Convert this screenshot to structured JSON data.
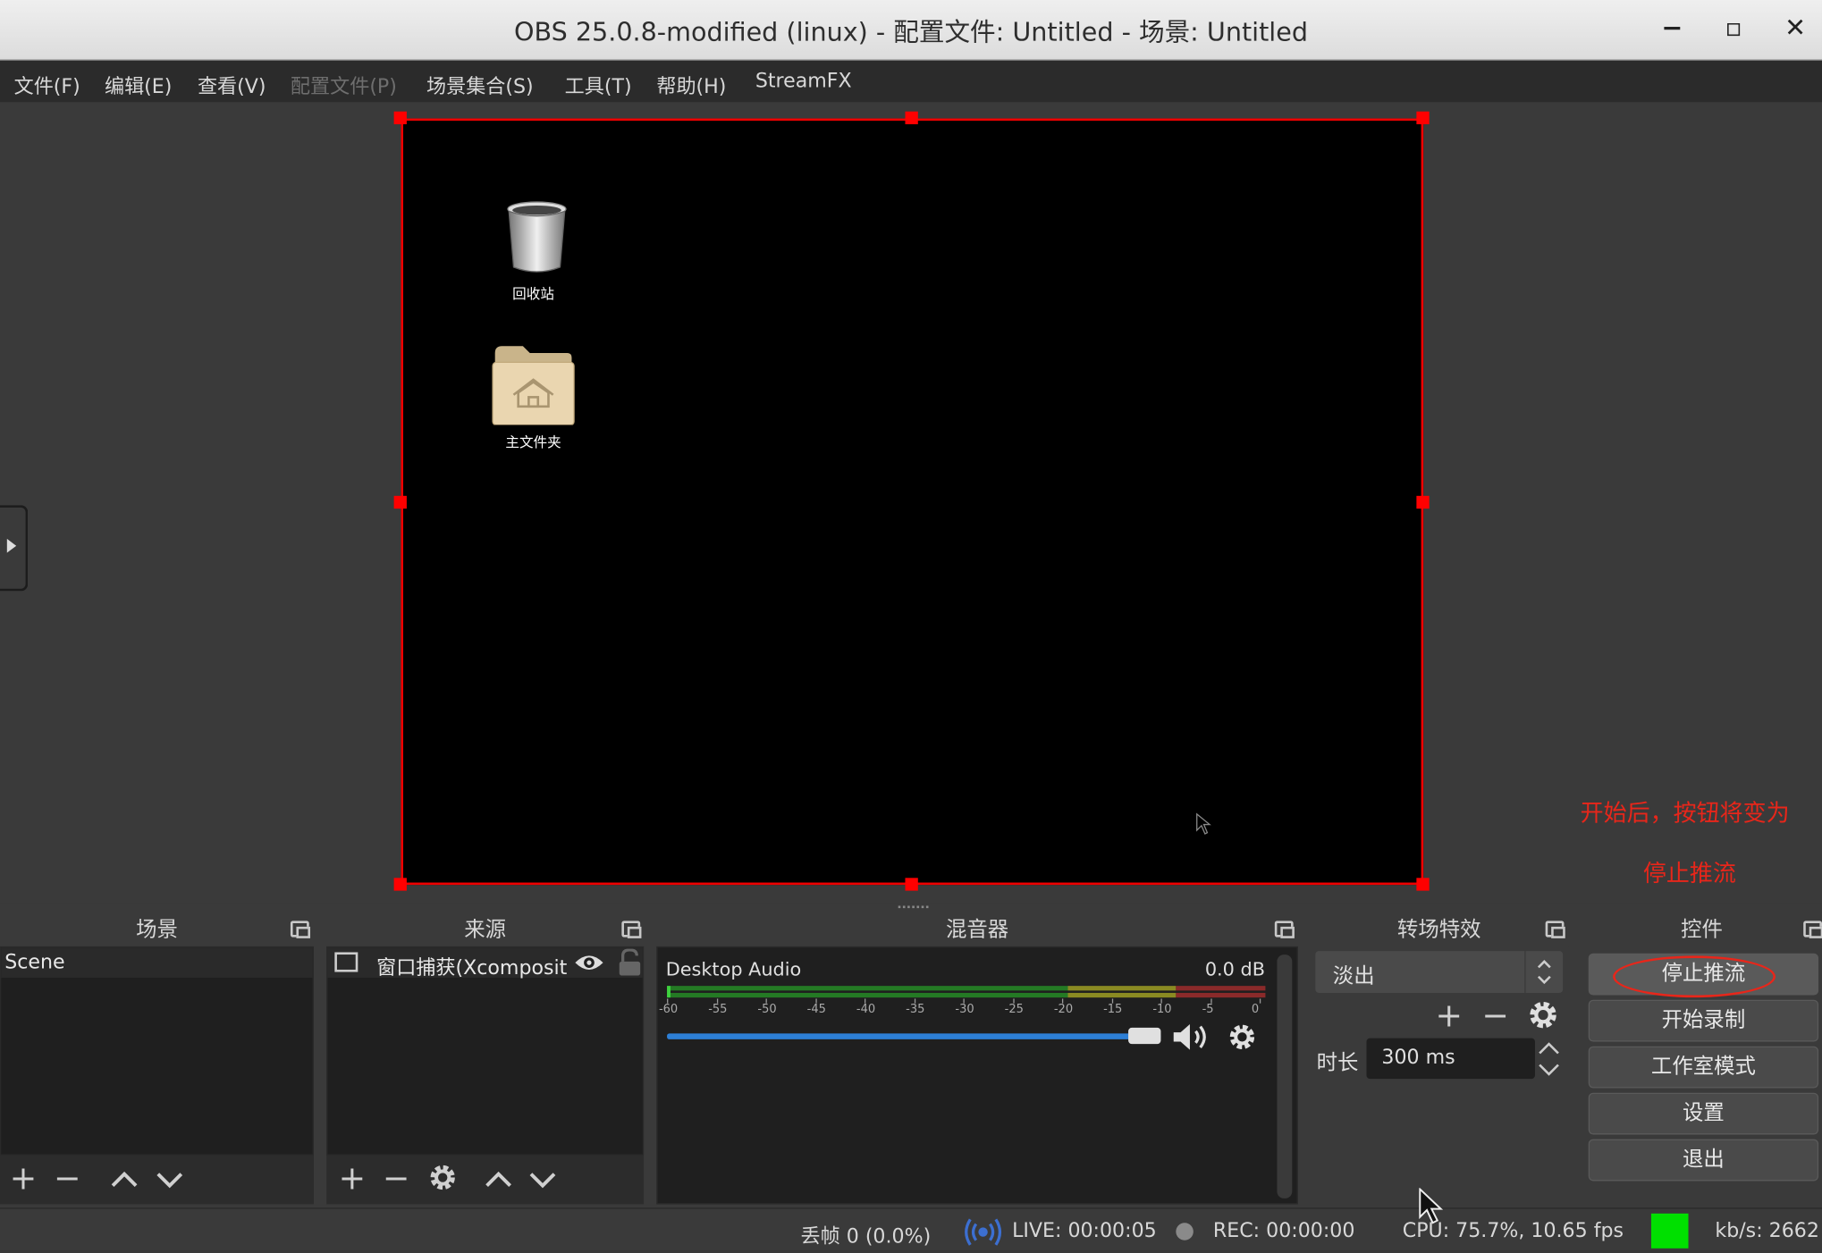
{
  "window": {
    "title": "OBS 25.0.8-modified (linux) - 配置文件: Untitled - 场景: Untitled",
    "minimize_glyph": "−",
    "maximize_glyph": "▫",
    "close_glyph": "✕"
  },
  "menubar": {
    "items": [
      "文件(F)",
      "编辑(E)",
      "查看(V)",
      "配置文件(P)",
      "场景集合(S)",
      "工具(T)",
      "帮助(H)",
      "StreamFX"
    ]
  },
  "preview": {
    "desktop_icons": [
      {
        "label": "回收站",
        "icon": "trash-icon"
      },
      {
        "label": "主文件夹",
        "icon": "home-folder-icon"
      }
    ]
  },
  "annotation": {
    "line1": "开始后，按钮将变为",
    "line2": "停止推流",
    "color": "#e8261a"
  },
  "docks": {
    "scenes": {
      "title": "场景",
      "items": [
        "Scene"
      ]
    },
    "sources": {
      "title": "来源",
      "items": [
        {
          "label": "窗口捕获(Xcomposit",
          "visible_icon": "eye-icon",
          "lock_icon": "unlock-icon"
        }
      ]
    },
    "mixer": {
      "title": "混音器",
      "channels": [
        {
          "name": "Desktop Audio",
          "level": "0.0 dB",
          "volume_fraction": 0.94
        }
      ],
      "scale_labels": [
        "-60",
        "-55",
        "-50",
        "-45",
        "-40",
        "-35",
        "-30",
        "-25",
        "-20",
        "-15",
        "-10",
        "-5",
        "0"
      ]
    },
    "transitions": {
      "title": "转场特效",
      "selected": "淡出",
      "duration_label": "时长",
      "duration_value": "300 ms"
    },
    "controls": {
      "title": "控件",
      "buttons": [
        "停止推流",
        "开始录制",
        "工作室模式",
        "设置",
        "退出"
      ]
    }
  },
  "statusbar": {
    "dropped_frames": "丢帧 0 (0.0%)",
    "live": "LIVE: 00:00:05",
    "rec": "REC: 00:00:00",
    "cpu": "CPU: 75.7%, 10.65 fps",
    "kbps": "kb/s: 2662",
    "indicator_color": "#00e000"
  }
}
